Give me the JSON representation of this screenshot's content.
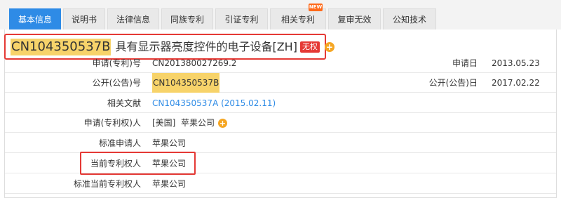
{
  "tabs": [
    {
      "label": "基本信息",
      "active": true
    },
    {
      "label": "说明书",
      "active": false
    },
    {
      "label": "法律信息",
      "active": false
    },
    {
      "label": "同族专利",
      "active": false
    },
    {
      "label": "引证专利",
      "active": false
    },
    {
      "label": "相关专利",
      "active": false,
      "badge": "NEW"
    },
    {
      "label": "复审无效",
      "active": false
    },
    {
      "label": "公知技术",
      "active": false
    }
  ],
  "header": {
    "patent_number": "CN104350537B",
    "title": "具有显示器亮度控件的电子设备[ZH]",
    "status": "无权"
  },
  "fields": {
    "application_no_label": "申请(专利)号",
    "application_no": "CN201380027269.2",
    "application_date_label": "申请日",
    "application_date": "2013.05.23",
    "publication_no_label": "公开(公告)号",
    "publication_no": "CN104350537B",
    "publication_date_label": "公开(公告)日",
    "publication_date": "2017.02.22",
    "related_doc_label": "相关文献",
    "related_doc": "CN104350537A (2015.02.11)",
    "applicant_label": "申请(专利权)人",
    "applicant_country": "[美国]",
    "applicant": "苹果公司",
    "std_applicant_label": "标准申请人",
    "std_applicant": "苹果公司",
    "current_owner_label": "当前专利权人",
    "current_owner": "苹果公司",
    "std_current_owner_label": "标准当前专利权人",
    "std_current_owner": "苹果公司"
  },
  "colors": {
    "tab_active": "#2e8be6",
    "highlight": "#f7d36a",
    "annotation_box": "#e53935",
    "add_icon": "#f5a623",
    "link": "#2e8be6"
  }
}
